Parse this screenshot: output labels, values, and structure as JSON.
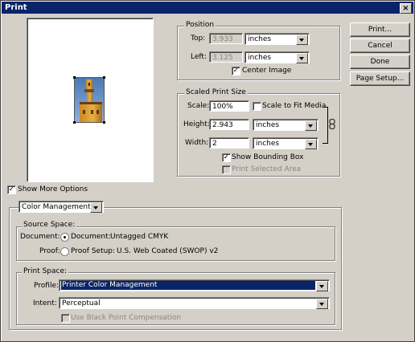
{
  "window": {
    "title": "Print",
    "close_glyph": "×"
  },
  "buttons": {
    "print": "Print...",
    "cancel": "Cancel",
    "done": "Done",
    "page_setup": "Page Setup..."
  },
  "position": {
    "legend": "Position",
    "top_label": "Top:",
    "top_value": "3.933",
    "top_unit": "inches",
    "left_label": "Left:",
    "left_value": "3.125",
    "left_unit": "inches",
    "center_label": "Center Image",
    "center_checked": true
  },
  "scaled": {
    "legend": "Scaled Print Size",
    "scale_label": "Scale:",
    "scale_value": "100%",
    "fit_label": "Scale to Fit Media",
    "fit_checked": false,
    "height_label": "Height:",
    "height_value": "2.943",
    "height_unit": "inches",
    "width_label": "Width:",
    "width_value": "2",
    "width_unit": "inches",
    "bbox_label": "Show Bounding Box",
    "bbox_checked": true,
    "selected_label": "Print Selected Area",
    "selected_checked": false
  },
  "more_options": {
    "label": "Show More Options",
    "checked": true
  },
  "color_mgmt": {
    "value": "Color Management"
  },
  "source": {
    "legend": "Source Space:",
    "document_label": "Document:",
    "document_option": "Document:",
    "document_value": "Untagged CMYK",
    "proof_label": "Proof:",
    "proof_option": "Proof Setup:",
    "proof_value": "U.S. Web Coated (SWOP) v2"
  },
  "print_space": {
    "legend": "Print Space:",
    "profile_label": "Profile:",
    "profile_value": "Printer Color Management",
    "intent_label": "Intent:",
    "intent_value": "Perceptual",
    "bpc_label": "Use Black Point Compensation",
    "bpc_checked": false
  },
  "icons": {
    "check": "✓",
    "link": "chain-link-icon"
  },
  "colors": {
    "titlebar": "#0a246a",
    "face": "#d4d0c8"
  }
}
